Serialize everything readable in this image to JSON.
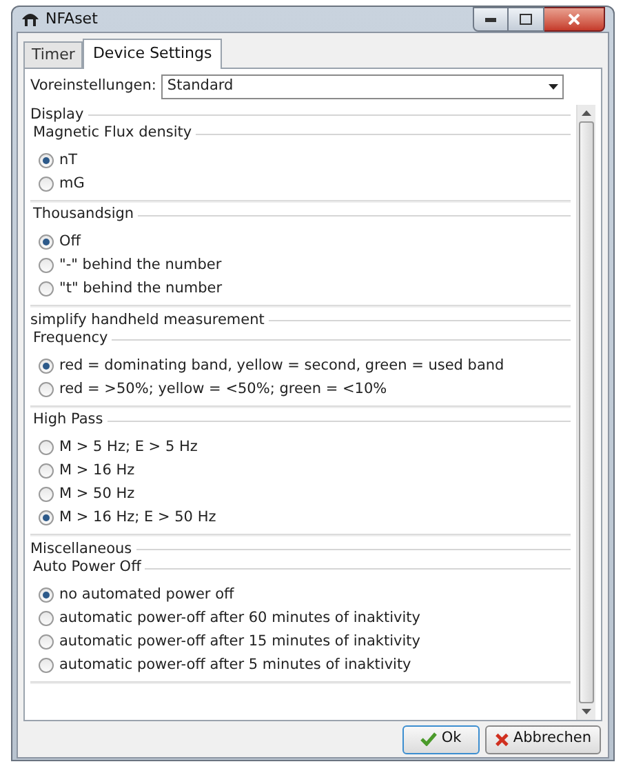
{
  "window": {
    "title": "NFAset"
  },
  "tabs": [
    {
      "label": "Timer",
      "selected": false
    },
    {
      "label": "Device Settings",
      "selected": true
    }
  ],
  "preset": {
    "label": "Voreinstellungen:",
    "value": "Standard"
  },
  "sections": [
    {
      "title": "Display",
      "groups": [
        {
          "title": "Magnetic Flux density",
          "options": [
            {
              "label": "nT",
              "selected": true
            },
            {
              "label": "mG",
              "selected": false
            }
          ]
        },
        {
          "title": "Thousandsign",
          "options": [
            {
              "label": "Off",
              "selected": true
            },
            {
              "label": "\"-\" behind the number",
              "selected": false
            },
            {
              "label": "\"t\" behind the number",
              "selected": false
            }
          ]
        }
      ]
    },
    {
      "title": "simplify handheld measurement",
      "groups": [
        {
          "title": "Frequency",
          "options": [
            {
              "label": "red = dominating band, yellow = second, green = used band",
              "selected": true
            },
            {
              "label": "red = >50%; yellow = <50%; green = <10%",
              "selected": false
            }
          ]
        },
        {
          "title": "High Pass",
          "options": [
            {
              "label": "M > 5 Hz; E > 5 Hz",
              "selected": false
            },
            {
              "label": "M > 16 Hz",
              "selected": false
            },
            {
              "label": "M > 50 Hz",
              "selected": false
            },
            {
              "label": "M > 16 Hz; E > 50 Hz",
              "selected": true
            }
          ]
        }
      ]
    },
    {
      "title": "Miscellaneous",
      "groups": [
        {
          "title": "Auto Power Off",
          "options": [
            {
              "label": "no automated power off",
              "selected": true
            },
            {
              "label": "automatic power-off after 60 minutes of inaktivity",
              "selected": false
            },
            {
              "label": "automatic power-off after 15 minutes of inaktivity",
              "selected": false
            },
            {
              "label": "automatic power-off after 5 minutes of inaktivity",
              "selected": false
            }
          ]
        }
      ]
    }
  ],
  "buttons": [
    {
      "label": "Ok",
      "kind": "ok"
    },
    {
      "label": "Abbrechen",
      "kind": "cancel"
    }
  ]
}
